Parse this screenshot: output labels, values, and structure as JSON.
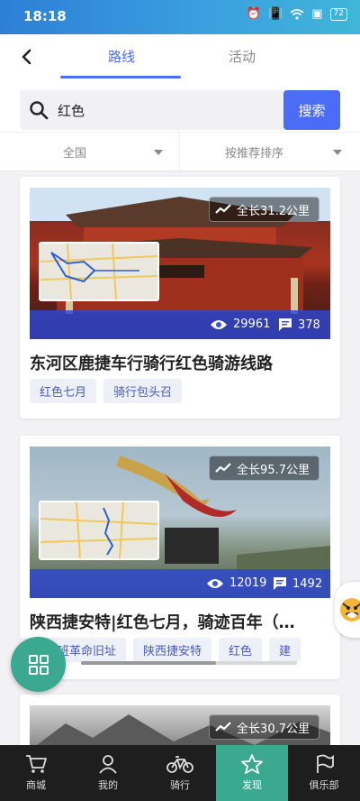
{
  "status": {
    "time": "18:18",
    "battery": "72"
  },
  "header": {
    "tabs": [
      {
        "label": "路线"
      },
      {
        "label": "活动"
      }
    ]
  },
  "search": {
    "value": "红色",
    "button": "搜索"
  },
  "filters": {
    "region": "全国",
    "sort": "按推荐排序"
  },
  "cards": [
    {
      "length": "全长31.2公里",
      "views": "29961",
      "comments": "378",
      "title": "东河区鹿捷车行骑行红色骑游线路",
      "tags": [
        "红色七月",
        "骑行包头召"
      ]
    },
    {
      "length": "全长95.7公里",
      "views": "12019",
      "comments": "1492",
      "title": "陕西捷安特|红色七月，骑迹百年（…",
      "tags": [
        "…青训班革命旧址",
        "陕西捷安特",
        "红色",
        "建"
      ]
    },
    {
      "length": "全长30.7公里"
    }
  ],
  "nav": [
    {
      "label": "商城",
      "icon": "cart-icon"
    },
    {
      "label": "我的",
      "icon": "user-icon"
    },
    {
      "label": "骑行",
      "icon": "bicycle-icon"
    },
    {
      "label": "发现",
      "icon": "star-icon"
    },
    {
      "label": "俱乐部",
      "icon": "flag-icon"
    }
  ],
  "colors": {
    "accent": "#4a6cf7",
    "green": "#3aa98f",
    "status_bar": "#2d7fd6"
  }
}
